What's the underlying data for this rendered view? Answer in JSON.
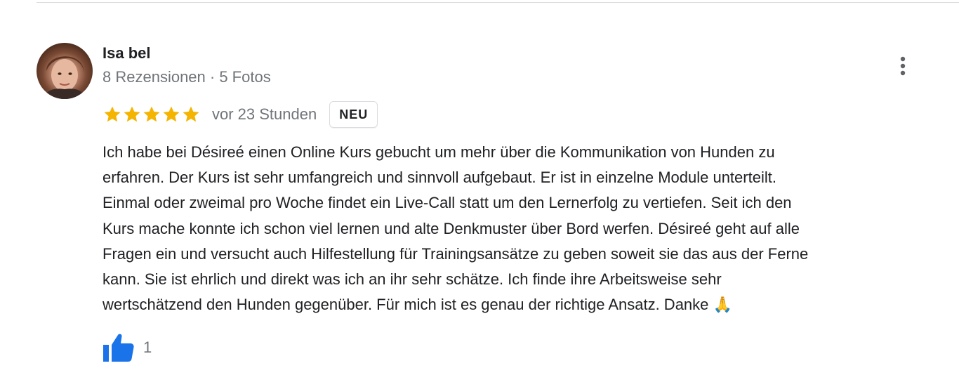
{
  "review": {
    "reviewer_name": "Isa bel",
    "reviewer_meta": "8 Rezensionen · 5 Fotos",
    "rating": 5,
    "rating_max": 5,
    "time": "vor 23 Stunden",
    "badge": "NEU",
    "text_lines": [
      "Ich habe bei Désireé einen Online Kurs gebucht um mehr über die Kommunikation von Hunden zu",
      "erfahren. Der Kurs ist sehr umfangreich und sinnvoll aufgebaut. Er ist in einzelne Module unterteilt.",
      "Einmal oder zweimal pro Woche findet ein Live-Call statt um den Lernerfolg zu vertiefen. Seit ich den",
      "Kurs mache konnte ich schon viel lernen und alte Denkmuster über Bord werfen. Désireé geht auf alle",
      "Fragen ein und versucht auch Hilfestellung für Trainingsansätze zu geben soweit sie das aus der Ferne",
      "kann. Sie ist ehrlich und direkt was ich an ihr sehr schätze. Ich finde ihre Arbeitsweise sehr",
      "wertschätzend den Hunden gegenüber. Für mich ist es genau der richtige Ansatz. Danke 🙏"
    ],
    "like_count": "1"
  },
  "icons": {
    "more": "more-vert-icon",
    "star": "star-icon",
    "like": "thumbs-up-icon"
  },
  "colors": {
    "star": "#f4b400",
    "like": "#1a73e8",
    "meta_text": "#70757a",
    "divider": "#dadce0"
  }
}
